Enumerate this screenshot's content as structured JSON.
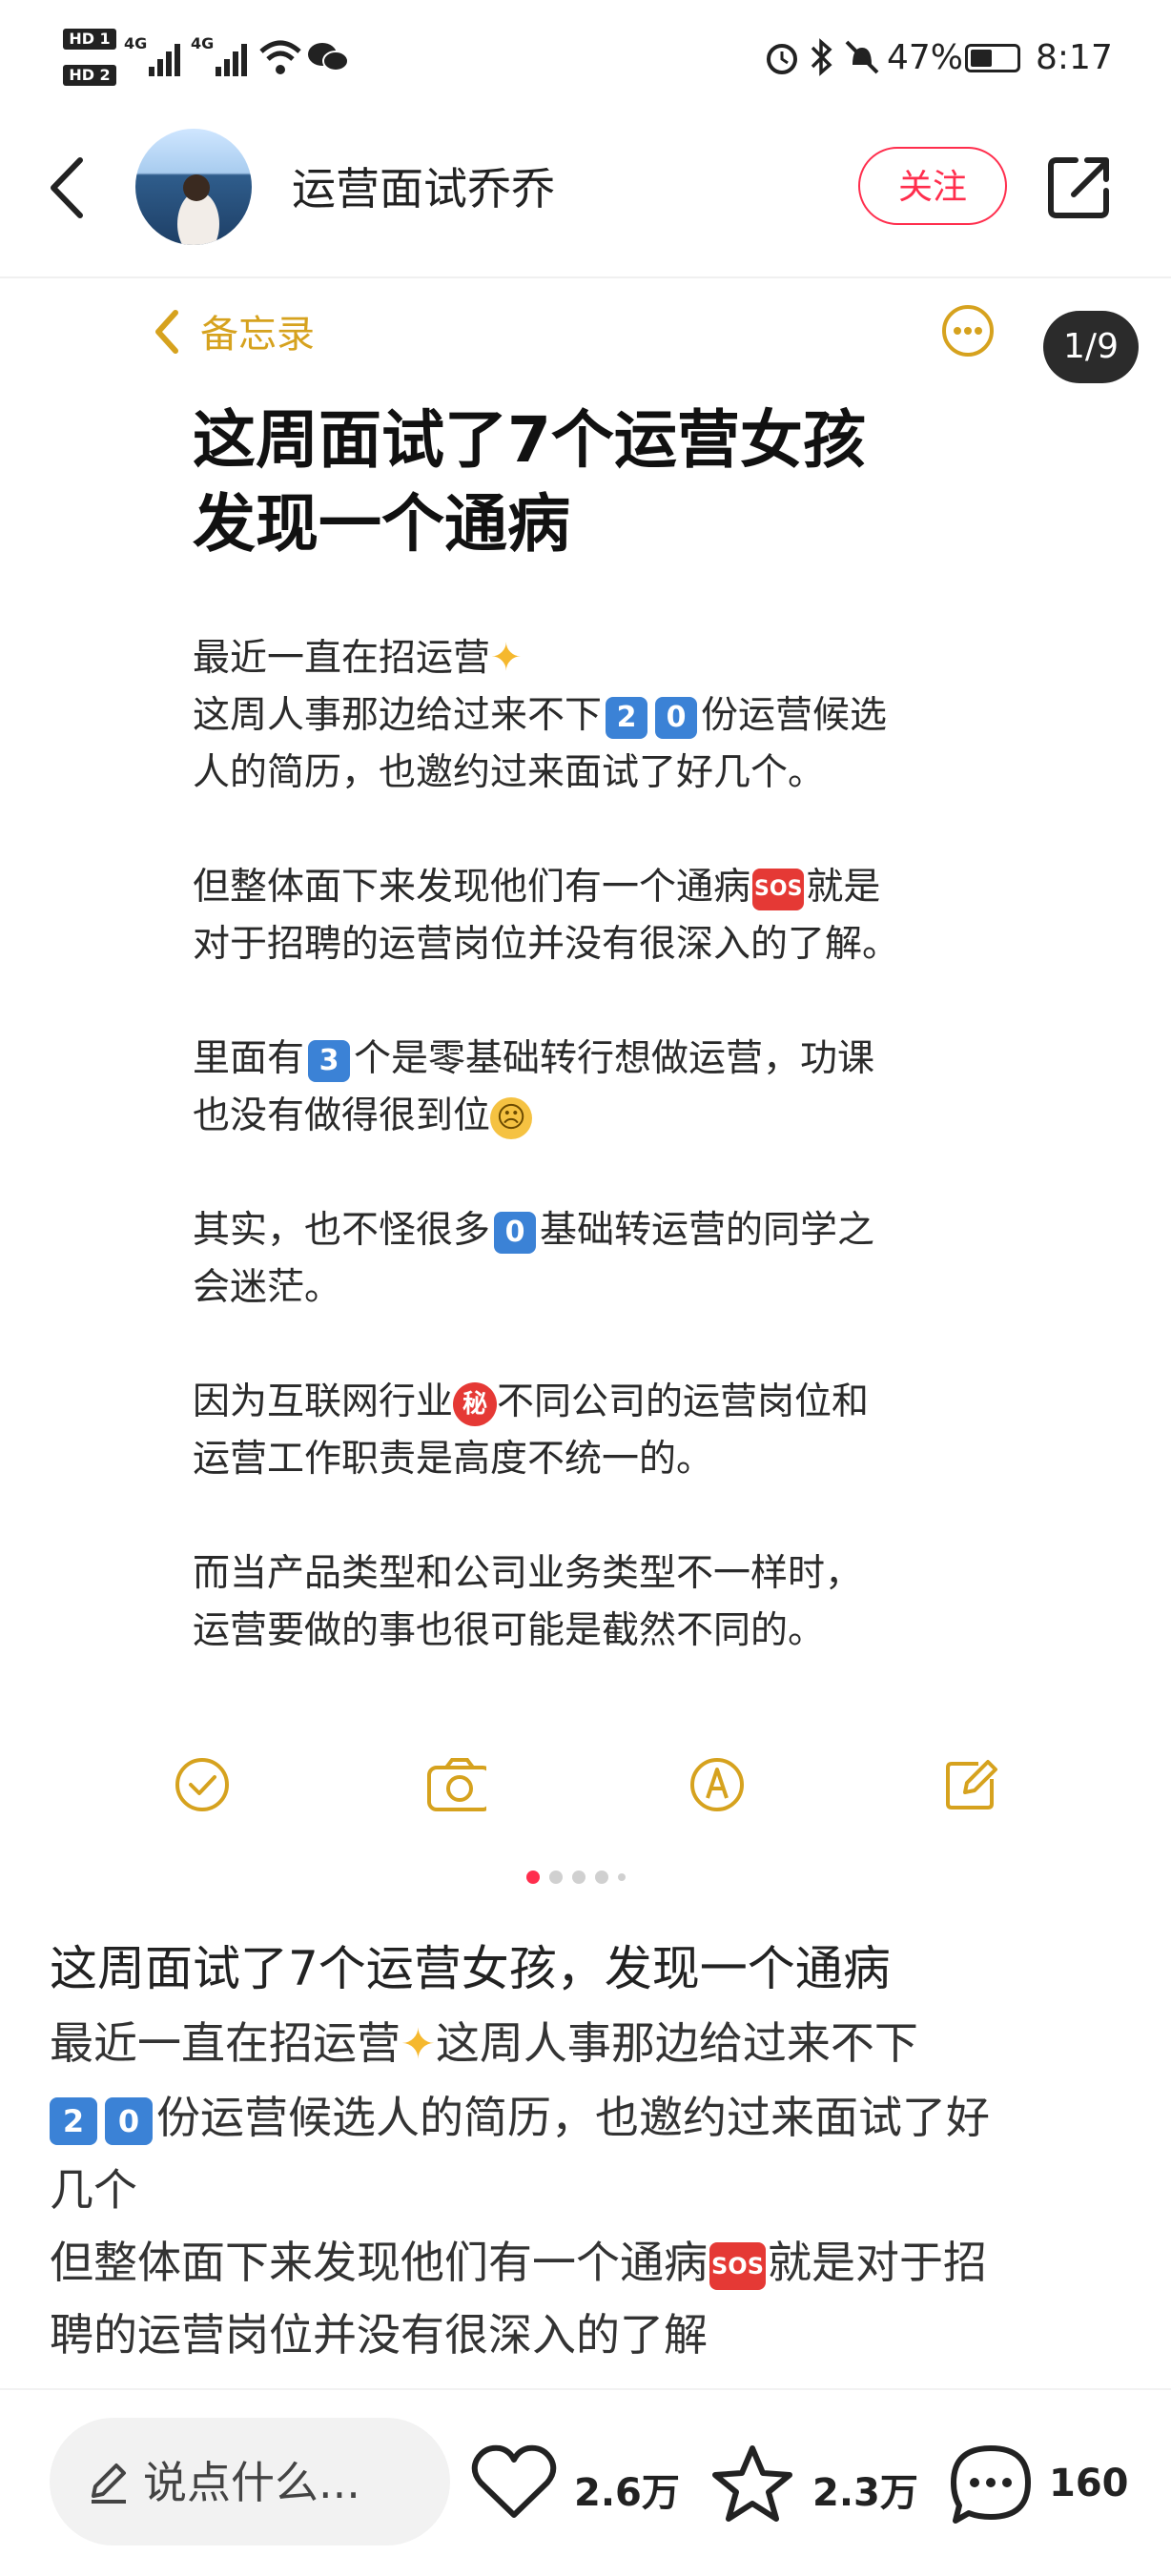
{
  "status_bar": {
    "hd1": "HD 1",
    "hd2": "HD 2",
    "sig_label": "4G",
    "battery": "47%",
    "time": "8:17"
  },
  "header": {
    "author_name": "运营面试乔乔",
    "follow_label": "关注"
  },
  "note_image": {
    "back_label": "备忘录",
    "page_counter": "1/9",
    "title": "这周面试了7个运营女孩\n发现一个通病",
    "p1a": "最近一直在招运营",
    "p1b": "这周人事那边给过来不下",
    "p1c": "份运营候选",
    "p1d": "人的简历，也邀约过来面试了好几个。",
    "p2a": "但整体面下来发现他们有一个通病",
    "p2b": "就是",
    "p2c": "对于招聘的运营岗位并没有很深入的了解。",
    "p3a": "里面有",
    "p3b": "个是零基础转行想做运营，功课",
    "p3c": "也没有做得很到位",
    "p4a": "其实，也不怪很多",
    "p4b": "基础转运营的同学之",
    "p4c": "会迷茫。",
    "p5a": "因为互联网行业",
    "p5b": "不同公司的运营岗位和",
    "p5c": "运营工作职责是高度不统一的。",
    "p6a": "而当产品类型和公司业务类型不一样时，",
    "p6b": "运营要做的事也很可能是截然不同的。",
    "keycap_2": "2",
    "keycap_0": "0",
    "keycap_3": "3",
    "sos": "SOS",
    "secret": "秘"
  },
  "post": {
    "title": "这周面试了7个运营女孩，发现一个通病",
    "line1a": "最近一直在招运营",
    "line1b": "这周人事那边给过来不下",
    "line2": "份运营候选人的简历，也邀约过来面试了好",
    "line3": "几个",
    "line4a": "但整体面下来发现他们有一个通病",
    "line4b": "就是对于招",
    "line5": "聘的运营岗位并没有很深入的了解"
  },
  "bottom_bar": {
    "comment_placeholder": "说点什么...",
    "likes": "2.6万",
    "collects": "2.3万",
    "comments": "160"
  },
  "colors": {
    "accent_red": "#ff2e4d",
    "memo_gold": "#d6a21e"
  }
}
